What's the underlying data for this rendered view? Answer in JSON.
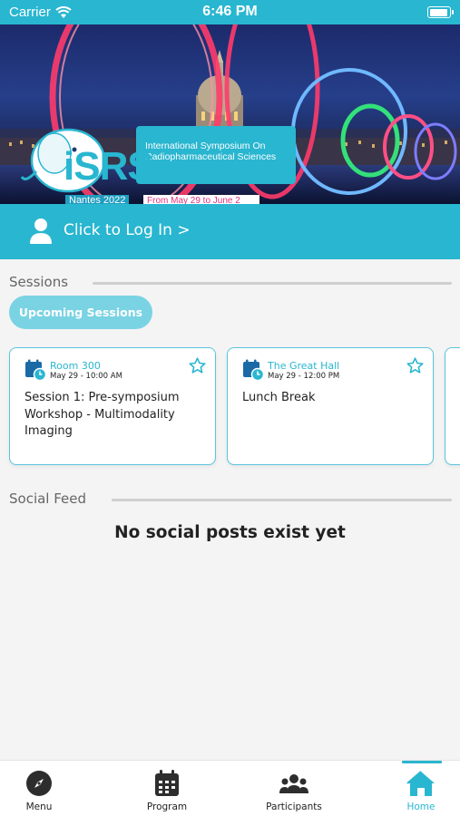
{
  "status_bar": {
    "carrier": "Carrier",
    "time": "6:46 PM"
  },
  "banner": {
    "logo_text": "iSRS",
    "logo_sub": "Nantes 2022",
    "title": "International Symposium On Radiopharmaceutical Sciences",
    "dates": "From May 29 to June 2"
  },
  "login": {
    "label": "Click to Log In >"
  },
  "sessions": {
    "heading": "Sessions",
    "filter_label": "Upcoming Sessions",
    "items": [
      {
        "room": "Room 300",
        "time": "May 29 - 10:00 AM",
        "title_lines": [
          "Session 1: Pre-symposium",
          "Workshop - Multimodality",
          "Imaging"
        ]
      },
      {
        "room": "The Great Hall",
        "time": "May 29 - 12:00 PM",
        "title_lines": [
          "Lunch Break"
        ]
      }
    ]
  },
  "social_feed": {
    "heading": "Social Feed",
    "empty_message": "No social posts exist yet"
  },
  "tab_bar": {
    "active": "Home",
    "tabs": [
      {
        "label": "Menu",
        "icon": "compass-icon"
      },
      {
        "label": "Program",
        "icon": "calendar-icon"
      },
      {
        "label": "Participants",
        "icon": "people-icon"
      },
      {
        "label": "Home",
        "icon": "home-icon"
      }
    ]
  },
  "colors": {
    "accent": "#29b6d0",
    "pill": "#7ad3e3",
    "card_border": "#5ac4db",
    "date_pink": "#e0327f"
  }
}
